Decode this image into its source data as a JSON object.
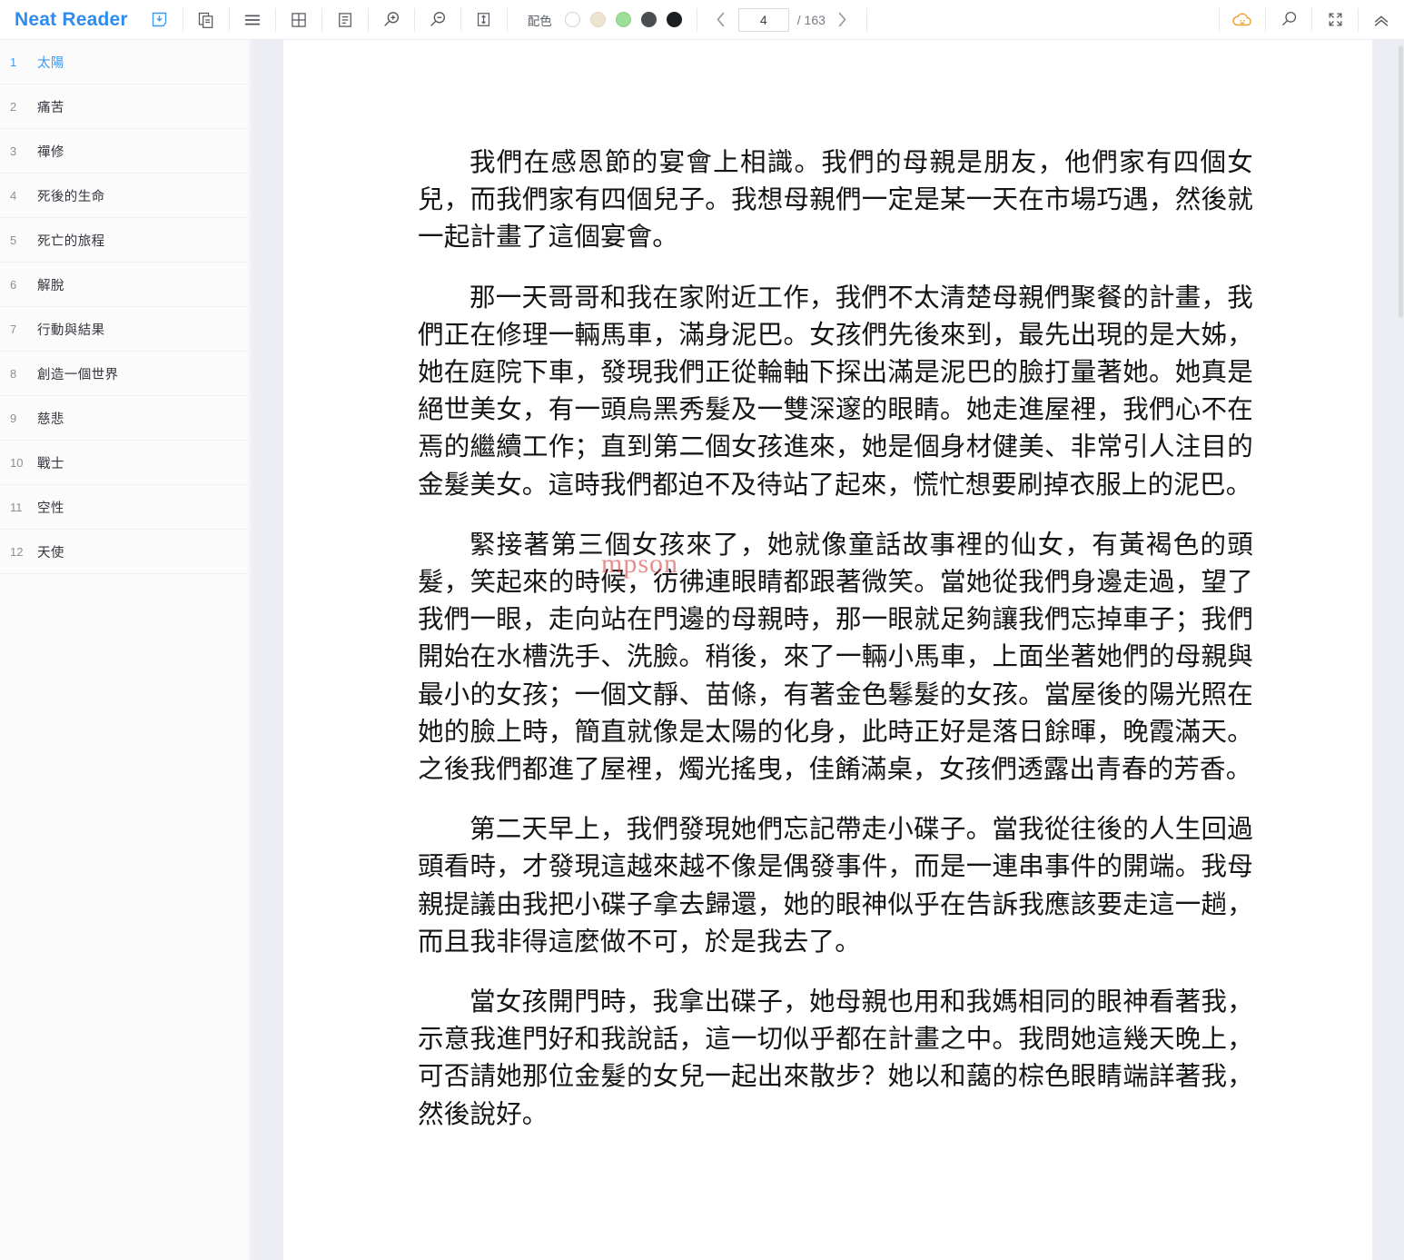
{
  "app": {
    "brand": "Neat Reader"
  },
  "toolbar": {
    "buttons": [
      {
        "name": "save-to-library-icon",
        "title": "Save"
      },
      {
        "name": "copy-pages-icon",
        "title": "Copy"
      },
      {
        "name": "list-view-icon",
        "title": "List view"
      },
      {
        "name": "grid-view-icon",
        "title": "Grid view"
      },
      {
        "name": "text-layout-icon",
        "title": "Text layout"
      },
      {
        "name": "zoom-in-icon",
        "title": "Zoom in"
      },
      {
        "name": "zoom-out-icon",
        "title": "Zoom out"
      },
      {
        "name": "line-height-icon",
        "title": "Line height"
      }
    ],
    "scheme": {
      "label": "配色",
      "swatches": [
        {
          "name": "scheme-white",
          "color": "#ffffff",
          "border": "#cfd3d8",
          "selected": false
        },
        {
          "name": "scheme-cream",
          "color": "#ede3d1",
          "border": "#e2d6c0",
          "selected": false
        },
        {
          "name": "scheme-green",
          "color": "#9fdd9a",
          "border": "#8fd08a",
          "selected": true
        },
        {
          "name": "scheme-gray",
          "color": "#4a4e52",
          "border": "#4a4e52",
          "selected": false
        },
        {
          "name": "scheme-black",
          "color": "#1d1f21",
          "border": "#1d1f21",
          "selected": false
        }
      ]
    },
    "pagination": {
      "prev_label": "‹",
      "next_label": "›",
      "current_page": "4",
      "total_label": "/ 163",
      "total_pages": "163"
    },
    "right_buttons": [
      {
        "name": "cloud-sync-icon",
        "title": "Cloud sync",
        "color": "#f0a030"
      },
      {
        "name": "search-icon",
        "title": "Search"
      },
      {
        "name": "fullscreen-icon",
        "title": "Fullscreen"
      },
      {
        "name": "collapse-toolbar-icon",
        "title": "Collapse"
      }
    ]
  },
  "sidebar": {
    "items": [
      {
        "num": "1",
        "label": "太陽",
        "active": true
      },
      {
        "num": "2",
        "label": "痛苦",
        "active": false
      },
      {
        "num": "3",
        "label": "禪修",
        "active": false
      },
      {
        "num": "4",
        "label": "死後的生命",
        "active": false
      },
      {
        "num": "5",
        "label": "死亡的旅程",
        "active": false
      },
      {
        "num": "6",
        "label": "解脫",
        "active": false
      },
      {
        "num": "7",
        "label": "行動與結果",
        "active": false
      },
      {
        "num": "8",
        "label": "創造一個世界",
        "active": false
      },
      {
        "num": "9",
        "label": "慈悲",
        "active": false
      },
      {
        "num": "10",
        "label": "戰士",
        "active": false
      },
      {
        "num": "11",
        "label": "空性",
        "active": false
      },
      {
        "num": "12",
        "label": "天使",
        "active": false
      }
    ]
  },
  "content": {
    "watermark": "mpson",
    "paragraphs": [
      "我們在感恩節的宴會上相識。我們的母親是朋友，他們家有四個女兒，而我們家有四個兒子。我想母親們一定是某一天在市場巧遇，然後就一起計畫了這個宴會。",
      "那一天哥哥和我在家附近工作，我們不太清楚母親們聚餐的計畫，我們正在修理一輛馬車，滿身泥巴。女孩們先後來到，最先出現的是大姊，她在庭院下車，發現我們正從輪軸下探出滿是泥巴的臉打量著她。她真是絕世美女，有一頭烏黑秀髮及一雙深邃的眼睛。她走進屋裡，我們心不在焉的繼續工作；直到第二個女孩進來，她是個身材健美、非常引人注目的金髮美女。這時我們都迫不及待站了起來，慌忙想要刷掉衣服上的泥巴。",
      "緊接著第三個女孩來了，她就像童話故事裡的仙女，有黃褐色的頭髮，笑起來的時候，彷彿連眼睛都跟著微笑。當她從我們身邊走過，望了我們一眼，走向站在門邊的母親時，那一眼就足夠讓我們忘掉車子；我們開始在水槽洗手、洗臉。稍後，來了一輛小馬車，上面坐著她們的母親與最小的女孩；一個文靜、苗條，有著金色鬈髮的女孩。當屋後的陽光照在她的臉上時，簡直就像是太陽的化身，此時正好是落日餘暉，晚霞滿天。之後我們都進了屋裡，燭光搖曳，佳餚滿桌，女孩們透露出青春的芳香。",
      "第二天早上，我們發現她們忘記帶走小碟子。當我從往後的人生回過頭看時，才發現這越來越不像是偶發事件，而是一連串事件的開端。我母親提議由我把小碟子拿去歸還，她的眼神似乎在告訴我應該要走這一趟，而且我非得這麼做不可，於是我去了。",
      "當女孩開門時，我拿出碟子，她母親也用和我媽相同的眼神看著我，示意我進門好和我說話，這一切似乎都在計畫之中。我問她這幾天晚上，可否請她那位金髮的女兒一起出來散步？她以和藹的棕色眼睛端詳著我，然後說好。"
    ]
  }
}
